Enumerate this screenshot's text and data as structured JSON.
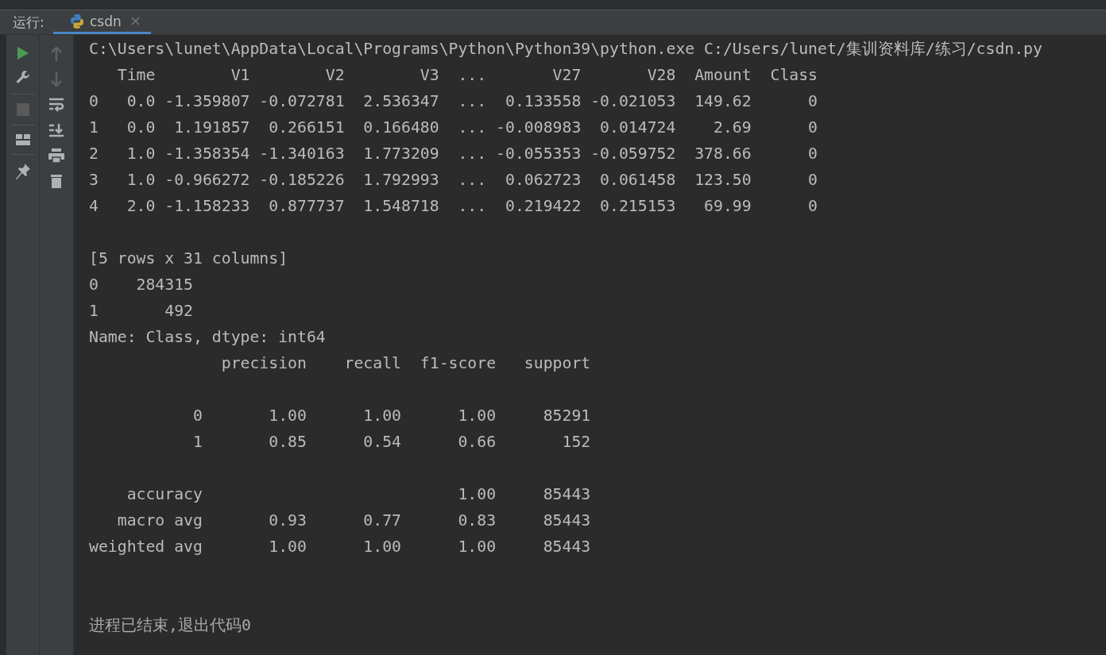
{
  "run_panel": {
    "label": "运行:",
    "tabs": [
      {
        "label": "csdn",
        "selected": true
      }
    ]
  },
  "console": {
    "lines": [
      {
        "kind": "text",
        "text": "C:\\Users\\lunet\\AppData\\Local\\Programs\\Python\\Python39\\python.exe C:/Users/lunet/集训资料库/练习/csdn.py"
      },
      {
        "kind": "text",
        "text": "   Time        V1        V2        V3  ...       V27       V28  Amount  Class"
      },
      {
        "kind": "text",
        "text": "0   0.0 -1.359807 -0.072781  2.536347  ...  0.133558 -0.021053  149.62      0"
      },
      {
        "kind": "text",
        "text": "1   0.0  1.191857  0.266151  0.166480  ... -0.008983  0.014724    2.69      0"
      },
      {
        "kind": "text",
        "text": "2   1.0 -1.358354 -1.340163  1.773209  ... -0.055353 -0.059752  378.66      0"
      },
      {
        "kind": "text",
        "text": "3   1.0 -0.966272 -0.185226  1.792993  ...  0.062723  0.061458  123.50      0"
      },
      {
        "kind": "text",
        "text": "4   2.0 -1.158233  0.877737  1.548718  ...  0.219422  0.215153   69.99      0"
      },
      {
        "kind": "blank"
      },
      {
        "kind": "text",
        "text": "[5 rows x 31 columns]"
      },
      {
        "kind": "text",
        "text": "0    284315"
      },
      {
        "kind": "text",
        "text": "1       492"
      },
      {
        "kind": "text",
        "text": "Name: Class, dtype: int64"
      },
      {
        "kind": "text",
        "text": "              precision    recall  f1-score   support"
      },
      {
        "kind": "blank"
      },
      {
        "kind": "text",
        "text": "           0       1.00      1.00      1.00     85291"
      },
      {
        "kind": "text",
        "text": "           1       0.85      0.54      0.66       152"
      },
      {
        "kind": "blank"
      },
      {
        "kind": "text",
        "text": "    accuracy                           1.00     85443"
      },
      {
        "kind": "text",
        "text": "   macro avg       0.93      0.77      0.83     85443"
      },
      {
        "kind": "text",
        "text": "weighted avg       1.00      1.00      1.00     85443"
      },
      {
        "kind": "blank"
      },
      {
        "kind": "blank"
      },
      {
        "kind": "exit",
        "text": "进程已结束,退出代码0"
      }
    ]
  }
}
